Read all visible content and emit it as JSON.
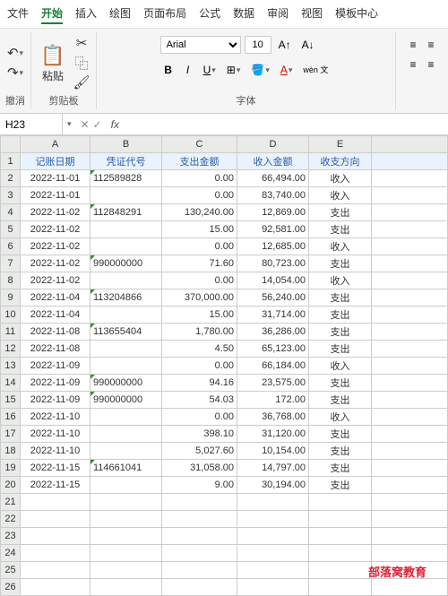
{
  "menu": {
    "file": "文件",
    "home": "开始",
    "insert": "插入",
    "draw": "绘图",
    "layout": "页面布局",
    "formula": "公式",
    "data": "数据",
    "review": "审阅",
    "view": "视图",
    "template": "模板中心"
  },
  "ribbon": {
    "undo": "撤消",
    "clipboard": "剪贴板",
    "paste": "粘贴",
    "font": "字体",
    "fontname": "Arial",
    "fontsize": "10",
    "wen": "wèn\n文"
  },
  "namebox": "H23",
  "cols": [
    "A",
    "B",
    "C",
    "D",
    "E"
  ],
  "headers": {
    "a": "记账日期",
    "b": "凭证代号",
    "c": "支出金额",
    "d": "收入金额",
    "e": "收支方向"
  },
  "rows": [
    {
      "n": 2,
      "a": "2022-11-01",
      "b": "112589828",
      "c": "0.00",
      "d": "66,494.00",
      "e": "收入",
      "tri": 1
    },
    {
      "n": 3,
      "a": "2022-11-01",
      "b": "",
      "c": "0.00",
      "d": "83,740.00",
      "e": "收入"
    },
    {
      "n": 4,
      "a": "2022-11-02",
      "b": "112848291",
      "c": "130,240.00",
      "d": "12,869.00",
      "e": "支出",
      "tri": 1
    },
    {
      "n": 5,
      "a": "2022-11-02",
      "b": "",
      "c": "15.00",
      "d": "92,581.00",
      "e": "支出"
    },
    {
      "n": 6,
      "a": "2022-11-02",
      "b": "",
      "c": "0.00",
      "d": "12,685.00",
      "e": "收入"
    },
    {
      "n": 7,
      "a": "2022-11-02",
      "b": "990000000",
      "c": "71.60",
      "d": "80,723.00",
      "e": "支出",
      "tri": 1,
      "cursor": 1
    },
    {
      "n": 8,
      "a": "2022-11-02",
      "b": "",
      "c": "0.00",
      "d": "14,054.00",
      "e": "收入"
    },
    {
      "n": 9,
      "a": "2022-11-04",
      "b": "113204866",
      "c": "370,000.00",
      "d": "56,240.00",
      "e": "支出",
      "tri": 1
    },
    {
      "n": 10,
      "a": "2022-11-04",
      "b": "",
      "c": "15.00",
      "d": "31,714.00",
      "e": "支出"
    },
    {
      "n": 11,
      "a": "2022-11-08",
      "b": "113655404",
      "c": "1,780.00",
      "d": "36,286.00",
      "e": "支出",
      "tri": 1
    },
    {
      "n": 12,
      "a": "2022-11-08",
      "b": "",
      "c": "4.50",
      "d": "65,123.00",
      "e": "支出"
    },
    {
      "n": 13,
      "a": "2022-11-09",
      "b": "",
      "c": "0.00",
      "d": "66,184.00",
      "e": "收入"
    },
    {
      "n": 14,
      "a": "2022-11-09",
      "b": "990000000",
      "c": "94.16",
      "d": "23,575.00",
      "e": "支出",
      "tri": 1
    },
    {
      "n": 15,
      "a": "2022-11-09",
      "b": "990000000",
      "c": "54.03",
      "d": "172.00",
      "e": "支出",
      "tri": 1
    },
    {
      "n": 16,
      "a": "2022-11-10",
      "b": "",
      "c": "0.00",
      "d": "36,768.00",
      "e": "收入"
    },
    {
      "n": 17,
      "a": "2022-11-10",
      "b": "",
      "c": "398.10",
      "d": "31,120.00",
      "e": "支出"
    },
    {
      "n": 18,
      "a": "2022-11-10",
      "b": "",
      "c": "5,027.60",
      "d": "10,154.00",
      "e": "支出"
    },
    {
      "n": 19,
      "a": "2022-11-15",
      "b": "114661041",
      "c": "31,058.00",
      "d": "14,797.00",
      "e": "支出",
      "tri": 1
    },
    {
      "n": 20,
      "a": "2022-11-15",
      "b": "",
      "c": "9.00",
      "d": "30,194.00",
      "e": "支出"
    }
  ],
  "empty_rows": [
    21,
    22,
    23,
    24,
    25,
    26
  ],
  "watermark": "部落窝教育"
}
